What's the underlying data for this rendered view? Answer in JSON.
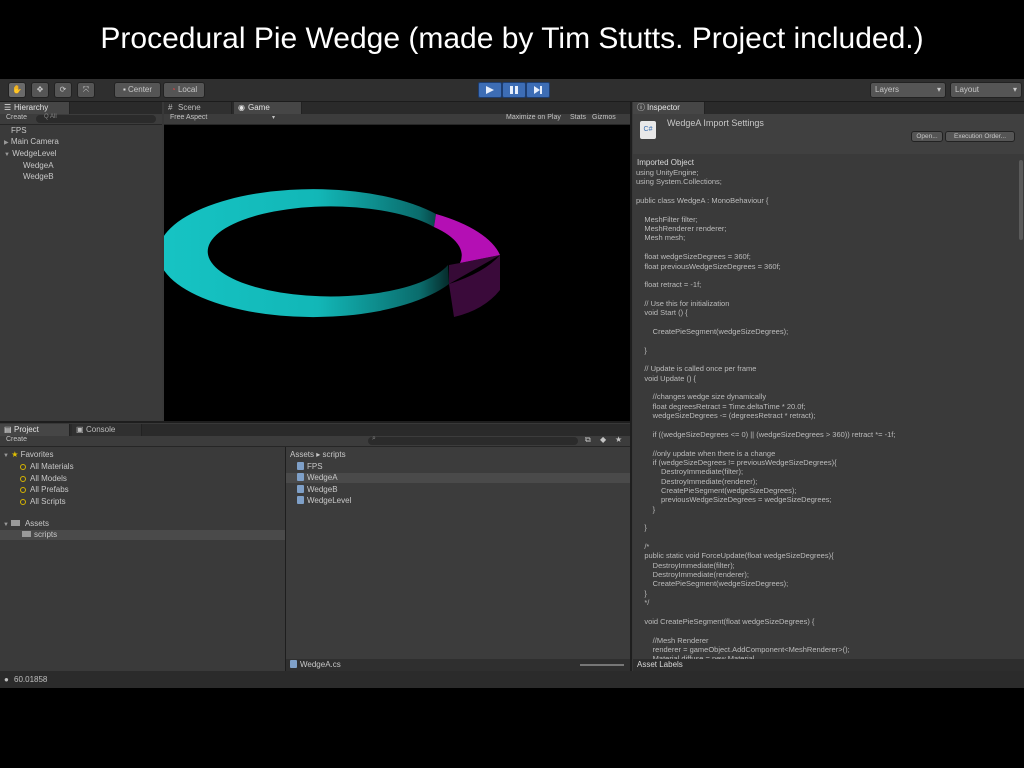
{
  "slide": {
    "title": "Procedural Pie Wedge (made by Tim Stutts.  Project included.)"
  },
  "toolbar": {
    "center_label": "Center",
    "local_label": "Local",
    "layers_label": "Layers",
    "layout_label": "Layout"
  },
  "hierarchy": {
    "tab_label": "Hierarchy",
    "create_label": "Create",
    "search_placeholder": "Q All",
    "items": [
      "FPS",
      "Main Camera",
      "WedgeLevel",
      "WedgeA",
      "WedgeB"
    ]
  },
  "viewport": {
    "scene_tab": "Scene",
    "game_tab": "Game",
    "aspect_label": "Free Aspect",
    "maximize_label": "Maximize on Play",
    "stats_label": "Stats",
    "gizmos_label": "Gizmos",
    "colors": {
      "wedge_a": "#17c3c3",
      "wedge_b": "#b40fb4",
      "background": "#000000"
    }
  },
  "project": {
    "tab_label": "Project",
    "console_tab": "Console",
    "create_label": "Create",
    "favorites_label": "Favorites",
    "favorites": [
      "All Materials",
      "All Models",
      "All Prefabs",
      "All Scripts"
    ],
    "assets_label": "Assets",
    "assets_children": [
      "scripts"
    ],
    "breadcrumb": "Assets ▸ scripts",
    "files": [
      "FPS",
      "WedgeA",
      "WedgeB",
      "WedgeLevel"
    ],
    "selected_file": "WedgeA",
    "footer_file": "WedgeA.cs"
  },
  "inspector": {
    "tab_label": "Inspector",
    "title": "WedgeA Import Settings",
    "open_label": "Open...",
    "exec_label": "Execution Order...",
    "section_label": "Imported Object",
    "asset_labels": "Asset Labels",
    "code_lines": [
      "using UnityEngine;",
      "using System.Collections;",
      "",
      "public class WedgeA : MonoBehaviour {",
      "",
      "    MeshFilter filter;",
      "    MeshRenderer renderer;",
      "    Mesh mesh;",
      "",
      "    float wedgeSizeDegrees = 360f;",
      "    float previousWedgeSizeDegrees = 360f;",
      "",
      "    float retract = -1f;",
      "",
      "    // Use this for initialization",
      "    void Start () {",
      "",
      "        CreatePieSegment(wedgeSizeDegrees);",
      "",
      "    }",
      "",
      "    // Update is called once per frame",
      "    void Update () {",
      "",
      "        //changes wedge size dynamically",
      "        float degreesRetract = Time.deltaTime * 20.0f;",
      "        wedgeSizeDegrees -= (degreesRetract * retract);",
      "",
      "        if ((wedgeSizeDegrees <= 0) || (wedgeSizeDegrees > 360)) retract *= -1f;",
      "",
      "        //only update when there is a change",
      "        if (wedgeSizeDegrees != previousWedgeSizeDegrees){",
      "            DestroyImmediate(filter);",
      "            DestroyImmediate(renderer);",
      "            CreatePieSegment(wedgeSizeDegrees);",
      "            previousWedgeSizeDegrees = wedgeSizeDegrees;",
      "        }",
      "",
      "    }",
      "",
      "    /*",
      "    public static void ForceUpdate(float wedgeSizeDegrees){",
      "        DestroyImmediate(filter);",
      "        DestroyImmediate(renderer);",
      "        CreatePieSegment(wedgeSizeDegrees);",
      "    }",
      "    */",
      "",
      "    void CreatePieSegment(float wedgeSizeDegrees) {",
      "",
      "        //Mesh Renderer",
      "        renderer = gameObject.AddComponent<MeshRenderer>();",
      "        Material diffuse = new Material"
    ]
  },
  "statusbar": {
    "text": "60.01858"
  }
}
